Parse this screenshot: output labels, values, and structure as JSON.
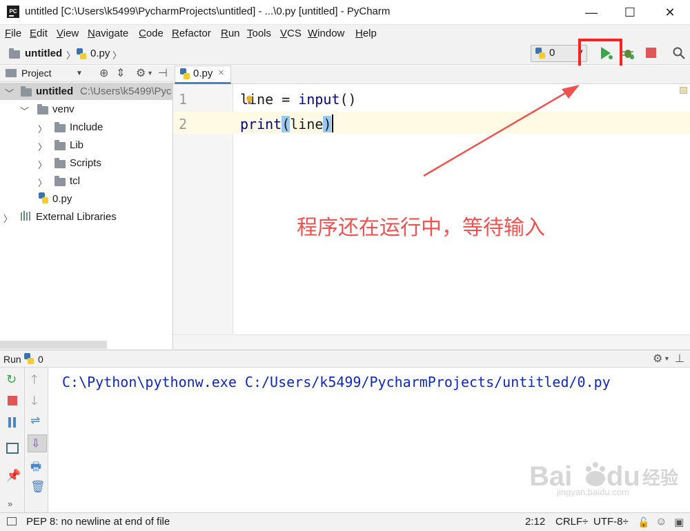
{
  "window": {
    "title": "untitled [C:\\Users\\k5499\\PycharmProjects\\untitled] - ...\\0.py [untitled] - PyCharm",
    "app_icon_text": "PC",
    "minimize_symbol": "—",
    "maximize_symbol": "☐",
    "close_symbol": "✕"
  },
  "menu": [
    "File",
    "Edit",
    "View",
    "Navigate",
    "Code",
    "Refactor",
    "Run",
    "Tools",
    "VCS",
    "Window",
    "Help"
  ],
  "breadcrumb": {
    "project": "untitled",
    "file": "0.py"
  },
  "toolbar": {
    "run_config": "0",
    "icons": [
      "run-icon",
      "debug-icon",
      "stop-icon",
      "search-icon"
    ]
  },
  "project_panel": {
    "title": "Project",
    "root": {
      "name": "untitled",
      "path": "C:\\Users\\k5499\\Pyc"
    },
    "items": [
      {
        "label": "venv"
      },
      {
        "label": "Include"
      },
      {
        "label": "Lib"
      },
      {
        "label": "Scripts"
      },
      {
        "label": "tcl"
      },
      {
        "label": "0.py"
      },
      {
        "label": "External Libraries"
      }
    ]
  },
  "editor": {
    "tab": {
      "label": "0.py",
      "close": "×"
    },
    "lines": [
      {
        "num": "1",
        "var": "line",
        "op": " = ",
        "fn": "input",
        "args": "()"
      },
      {
        "num": "2",
        "fn": "print",
        "open": "(",
        "arg": "line",
        "close": ")"
      }
    ]
  },
  "annotation": "程序还在运行中，等待输入",
  "run_panel": {
    "title": "Run",
    "config": "0",
    "console_output": "C:\\Python\\pythonw.exe C:/Users/k5499/PycharmProjects/untitled/0.py",
    "more": "»"
  },
  "status": {
    "message": "PEP 8: no newline at end of file",
    "position": "2:12",
    "line_sep": "CRLF÷",
    "encoding": "UTF-8÷"
  },
  "watermark": {
    "brand": "Bai",
    "paw": "du",
    "cn": "经验",
    "url": "jingyan.baidu.com"
  },
  "colors": {
    "accent": "#4083c9",
    "annotation": "#f0524f",
    "highlight_box": "#ff2020",
    "run_green": "#3aa64a",
    "stop_red": "#e05555",
    "console_blue": "#0d28b8"
  }
}
